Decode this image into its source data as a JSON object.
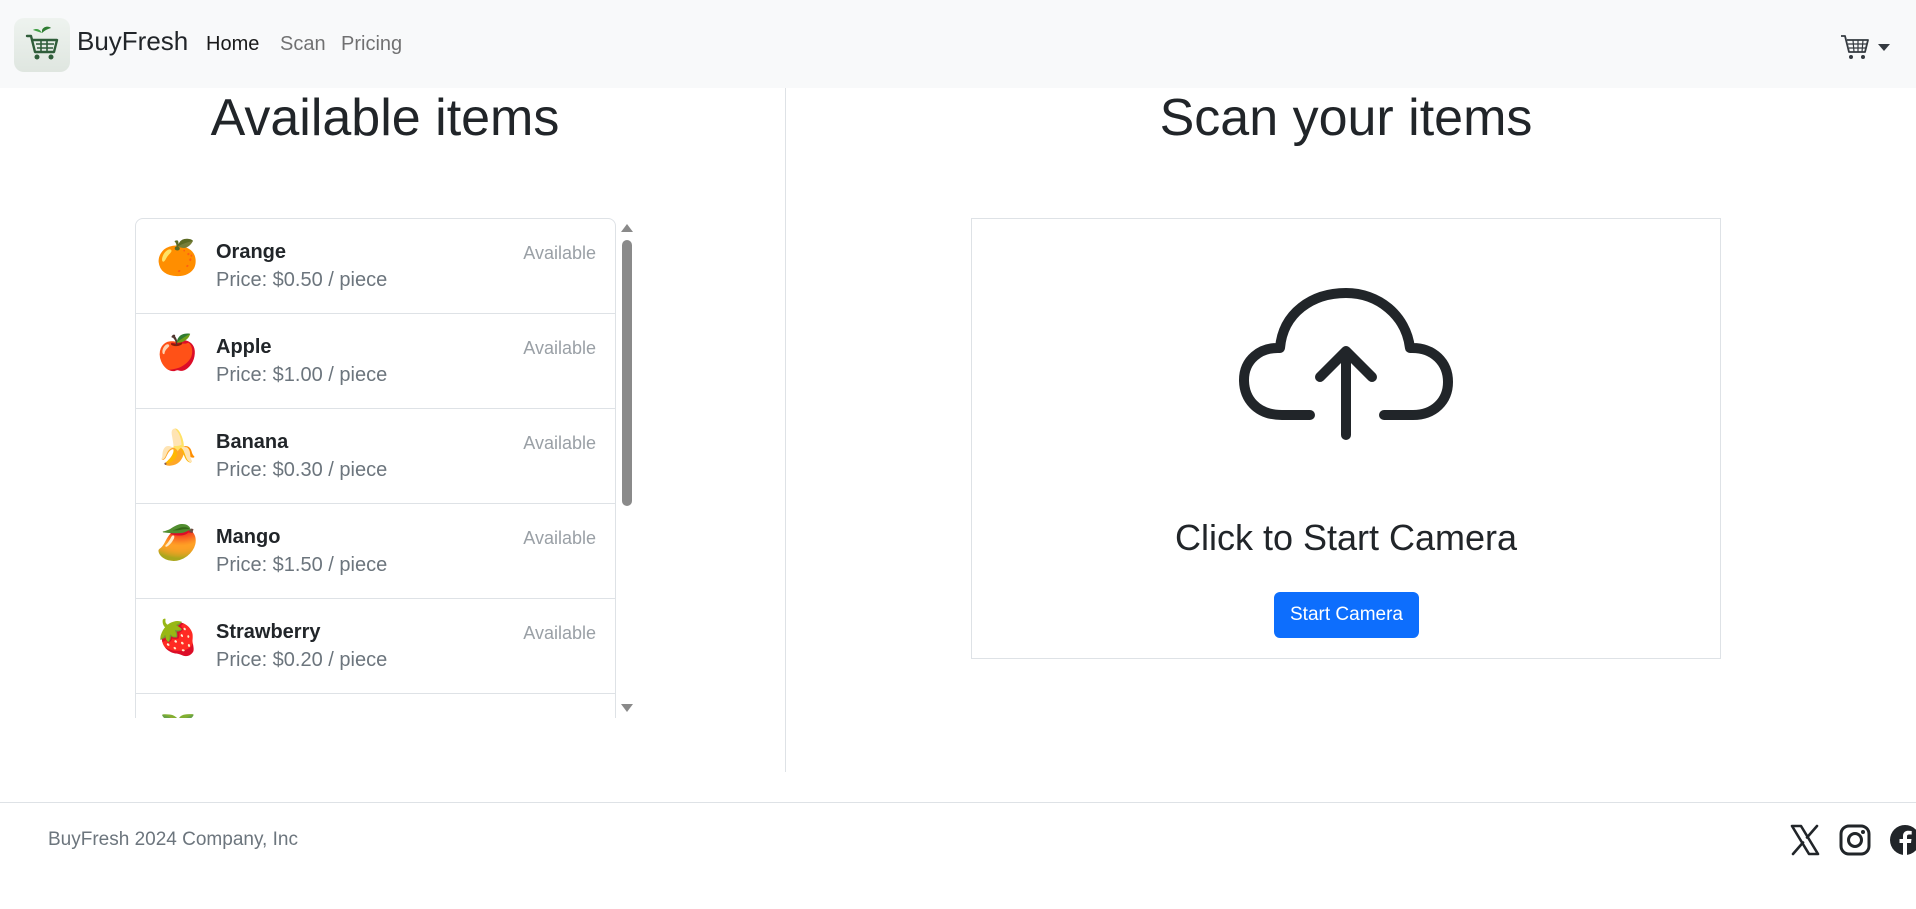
{
  "nav": {
    "brand": "BuyFresh",
    "links": [
      {
        "label": "Home",
        "active": true
      },
      {
        "label": "Scan",
        "active": false
      },
      {
        "label": "Pricing",
        "active": false
      }
    ],
    "cart_icon": "cart-icon"
  },
  "left": {
    "title": "Available items",
    "items": [
      {
        "icon": "🍊",
        "name": "Orange",
        "price": "Price: $0.50 / piece",
        "status": "Available"
      },
      {
        "icon": "🍎",
        "name": "Apple",
        "price": "Price: $1.00 / piece",
        "status": "Available"
      },
      {
        "icon": "🍌",
        "name": "Banana",
        "price": "Price: $0.30 / piece",
        "status": "Available"
      },
      {
        "icon": "🥭",
        "name": "Mango",
        "price": "Price: $1.50 / piece",
        "status": "Available"
      },
      {
        "icon": "🍓",
        "name": "Strawberry",
        "price": "Price: $0.20 / piece",
        "status": "Available"
      },
      {
        "icon": "🍑",
        "name": "",
        "price": "",
        "status": ""
      }
    ]
  },
  "right": {
    "title": "Scan your items",
    "prompt": "Click to Start Camera",
    "button": "Start Camera",
    "icon": "cloud-upload-icon"
  },
  "footer": {
    "text": "BuyFresh 2024 Company, Inc",
    "social": [
      "x-icon",
      "instagram-icon",
      "facebook-icon"
    ]
  },
  "colors": {
    "primary": "#0d6efd",
    "navbar_bg": "#f8f9fa",
    "muted": "#6c757d"
  }
}
